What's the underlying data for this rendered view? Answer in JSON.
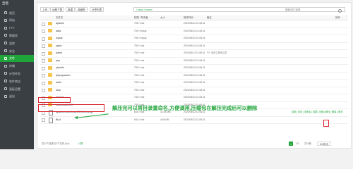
{
  "sidebar": {
    "logo": "宝塔",
    "items": [
      {
        "label": "首页"
      },
      {
        "label": "网站"
      },
      {
        "label": "FTP"
      },
      {
        "label": "数据库"
      },
      {
        "label": "监控"
      },
      {
        "label": "安全"
      },
      {
        "label": "文件"
      },
      {
        "label": "终端"
      },
      {
        "label": "计划任务"
      },
      {
        "label": "软件商店"
      },
      {
        "label": "面板设置"
      },
      {
        "label": "退出"
      }
    ]
  },
  "toolbar": {
    "buttons": [
      "上传",
      "远程下载",
      "新建",
      "收藏夹",
      "分享列表"
    ],
    "path": "/ www / server",
    "search_placeholder": "搜索文件/目录"
  },
  "table": {
    "headers": {
      "name": "文件名",
      "perm": "权限 / 所有者",
      "size": "大小",
      "mtime": "修改时间",
      "remark": "备注",
      "ops": "操作"
    },
    "rows": [
      {
        "name": "apache",
        "type": "folder",
        "perm": "755 / root",
        "size": "",
        "mtime": "2021/06/12 11:06:11",
        "remark": ""
      },
      {
        "name": "data",
        "type": "folder",
        "perm": "755 / mysql",
        "size": "",
        "mtime": "2021/06/12 11:06:11",
        "remark": ""
      },
      {
        "name": "mysql",
        "type": "folder",
        "perm": "755 / mysql",
        "size": "",
        "mtime": "2021/06/12 11:06:11",
        "remark": ""
      },
      {
        "name": "nginx",
        "type": "folder",
        "perm": "755 / root",
        "size": "",
        "mtime": "2021/06/12 11:06:11",
        "remark": ""
      },
      {
        "name": "panel",
        "type": "folder",
        "perm": "755 / root",
        "size": "",
        "mtime": "2021/06/12 11:06:11",
        "remark": "PS: 宝塔主程序目录"
      },
      {
        "name": "php",
        "type": "folder",
        "perm": "755 / root",
        "size": "",
        "mtime": "2021/06/12 11:06:11",
        "remark": ""
      },
      {
        "name": "phpinfo",
        "type": "folder",
        "perm": "755 / root",
        "size": "",
        "mtime": "2021/06/12 11:06:11",
        "remark": ""
      },
      {
        "name": "phpmyadmin",
        "type": "folder",
        "perm": "755 / root",
        "size": "",
        "mtime": "2021/06/12 11:06:11",
        "remark": ""
      },
      {
        "name": "redis",
        "type": "folder",
        "perm": "755 / root",
        "size": "",
        "mtime": "2021/06/12 11:06:11",
        "remark": ""
      },
      {
        "name": "stop",
        "type": "folder",
        "perm": "755 / root",
        "size": "",
        "mtime": "2021/06/12 11:06:11",
        "remark": ""
      },
      {
        "name": "tomcat",
        "type": "folder",
        "perm": "755 / root",
        "size": "",
        "mtime": "2021/06/12 11:06:11",
        "remark": ""
      },
      {
        "name": "rocketmq-4.5.0",
        "type": "folder",
        "perm": "755 / root",
        "size": "",
        "mtime": "2021/06/12 11:06:11",
        "remark": ""
      },
      {
        "name": "apache-rocketmq-4.5.0-bin-tar.gz",
        "type": "file",
        "perm": "644 / root",
        "size": "12.04 MB",
        "mtime": "2021/06/12 11:06:11",
        "remark": ""
      },
      {
        "name": "Bt.pl",
        "type": "file",
        "perm": "644 / root",
        "size": "4.56 KB",
        "mtime": "2021/06/12 11:06:11",
        "remark": ""
      }
    ],
    "file_ops": "复制 | 剪切 | 重命名 | 权限 | 压缩 | 解压 | 删除 | 更多"
  },
  "annotation": "解压完可以将目录重命名,方便调用,压缩包在解压完成后可以删除",
  "footer": {
    "summary": "共12个目录与2个文件,大小:",
    "calc_link": "计算",
    "page_current": "1",
    "page_info": "1/1",
    "page_total": "共14条",
    "per_page": "100条/页"
  },
  "colors": {
    "accent": "#20a53a",
    "highlight": "#d9262f",
    "sidebar": "#3a3f44",
    "folder": "#f7c34d"
  }
}
